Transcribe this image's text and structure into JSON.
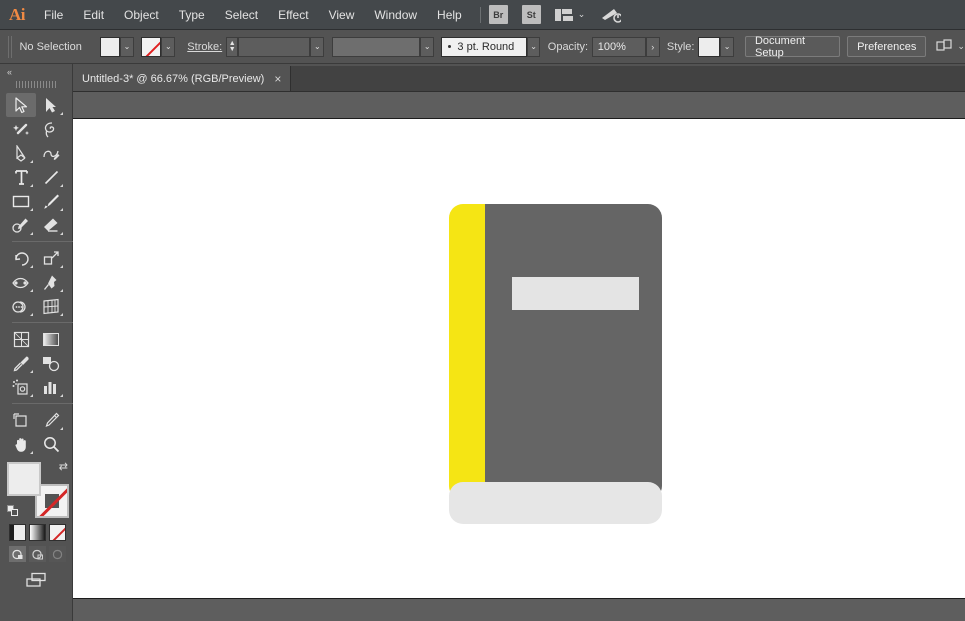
{
  "app": {
    "name": "Adobe Illustrator",
    "logo_text": "Ai"
  },
  "menubar": {
    "items": [
      {
        "label": "File"
      },
      {
        "label": "Edit"
      },
      {
        "label": "Object"
      },
      {
        "label": "Type"
      },
      {
        "label": "Select"
      },
      {
        "label": "Effect"
      },
      {
        "label": "View"
      },
      {
        "label": "Window"
      },
      {
        "label": "Help"
      }
    ],
    "bridge_chip": "Br",
    "stock_chip": "St",
    "workspace_icon": "workspace-switcher-icon",
    "chevron": "⌄",
    "search_icon": "search-adobe-stock-icon"
  },
  "controlbar": {
    "selection_status": "No Selection",
    "fill_swatch_label": "fill-swatch",
    "fill_color": "#ededed",
    "stroke_swatch_label": "stroke-none-swatch",
    "stroke_label": "Stroke:",
    "stroke_weight": "",
    "stroke_weight_placeholder": "",
    "stroke_profile": "",
    "brush_definition": "3 pt. Round",
    "opacity_label": "Opacity:",
    "opacity_value": "100%",
    "style_label": "Style:",
    "style_swatch_color": "#ededed",
    "document_setup_label": "Document Setup",
    "preferences_label": "Preferences",
    "arrange_documents_icon": "arrange-documents-icon",
    "chevron": "⌄",
    "expand_arrow": "›"
  },
  "tabbar": {
    "tabs": [
      {
        "title": "Untitled-3* @ 66.67% (RGB/Preview)",
        "close": "×",
        "active": true
      }
    ]
  },
  "toolbar": {
    "collapse_label": "«",
    "tools": [
      {
        "name": "selection-tool",
        "active": true,
        "has_flyout": false
      },
      {
        "name": "direct-selection-tool",
        "active": false,
        "has_flyout": true
      },
      {
        "name": "magic-wand-tool",
        "active": false,
        "has_flyout": false
      },
      {
        "name": "lasso-tool",
        "active": false,
        "has_flyout": false
      },
      {
        "name": "pen-tool",
        "active": false,
        "has_flyout": true
      },
      {
        "name": "curvature-tool",
        "active": false,
        "has_flyout": false
      },
      {
        "name": "type-tool",
        "active": false,
        "has_flyout": true
      },
      {
        "name": "line-segment-tool",
        "active": false,
        "has_flyout": true
      },
      {
        "name": "rectangle-tool",
        "active": false,
        "has_flyout": true
      },
      {
        "name": "paintbrush-tool",
        "active": false,
        "has_flyout": true
      },
      {
        "name": "shaper-pencil-tool",
        "active": false,
        "has_flyout": true
      },
      {
        "name": "eraser-tool",
        "active": false,
        "has_flyout": true
      },
      {
        "name": "rotate-tool",
        "active": false,
        "has_flyout": true
      },
      {
        "name": "scale-tool",
        "active": false,
        "has_flyout": true
      },
      {
        "name": "width-tool",
        "active": false,
        "has_flyout": true
      },
      {
        "name": "free-transform-tool",
        "active": false,
        "has_flyout": true
      },
      {
        "name": "shape-builder-tool",
        "active": false,
        "has_flyout": true
      },
      {
        "name": "perspective-grid-tool",
        "active": false,
        "has_flyout": true
      },
      {
        "name": "mesh-tool",
        "active": false,
        "has_flyout": false
      },
      {
        "name": "gradient-tool",
        "active": false,
        "has_flyout": false
      },
      {
        "name": "eyedropper-tool",
        "active": false,
        "has_flyout": true
      },
      {
        "name": "blend-tool",
        "active": false,
        "has_flyout": false
      },
      {
        "name": "symbol-sprayer-tool",
        "active": false,
        "has_flyout": true
      },
      {
        "name": "column-graph-tool",
        "active": false,
        "has_flyout": true
      },
      {
        "name": "artboard-tool",
        "active": false,
        "has_flyout": false
      },
      {
        "name": "slice-tool",
        "active": false,
        "has_flyout": true
      },
      {
        "name": "hand-tool",
        "active": false,
        "has_flyout": true
      },
      {
        "name": "zoom-tool",
        "active": false,
        "has_flyout": false
      }
    ],
    "fill_color": "#ededed",
    "stroke_color": "none",
    "swap_icon": "swap-fill-stroke-icon",
    "default_icon": "default-fill-stroke-icon",
    "color_mode_label": "color-mode-button",
    "gradient_mode_label": "gradient-mode-button",
    "none_mode_label": "none-mode-button",
    "screen_modes": [
      {
        "name": "normal-screen-mode",
        "selected": true
      },
      {
        "name": "full-screen-menubar-mode",
        "selected": false
      },
      {
        "name": "full-screen-mode",
        "selected": false
      }
    ],
    "edit_toolbar_icon": "edit-toolbar-icon"
  },
  "canvas": {
    "background_color": "#ffffff",
    "artwork": {
      "name": "book-illustration",
      "spine_color": "#f5e514",
      "cover_color": "#656565",
      "label_color": "#e4e4e4",
      "pages_color": "#e6e6e6"
    }
  }
}
